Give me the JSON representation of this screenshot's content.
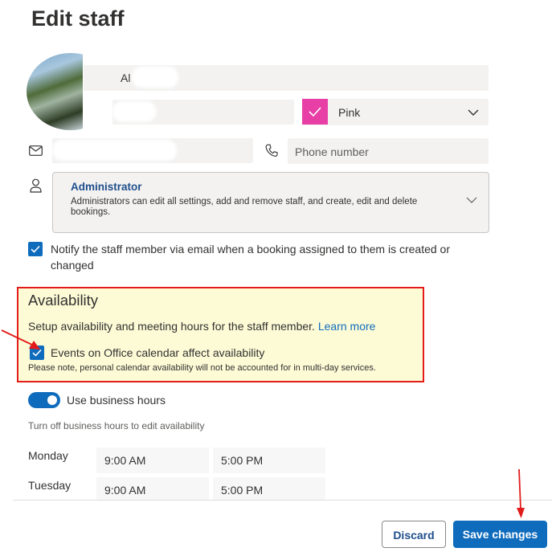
{
  "header": {
    "title": "Edit staff"
  },
  "profile": {
    "name_partial": "Al",
    "color_value": "Pink",
    "phone_placeholder": "Phone number"
  },
  "role": {
    "name": "Administrator",
    "description": "Administrators can edit all settings, add and remove staff, and create, edit and delete bookings."
  },
  "notify": {
    "checked": true,
    "label": "Notify the staff member via email when a booking assigned to them is created or changed"
  },
  "availability": {
    "heading": "Availability",
    "description": "Setup availability and meeting hours for the staff member.",
    "learn_more": "Learn more",
    "office_calendar_checked": true,
    "office_calendar_label": "Events on Office calendar affect availability",
    "note": "Please note, personal calendar availability will not be accounted for in multi-day services."
  },
  "business_hours": {
    "enabled": true,
    "label": "Use business hours",
    "hint": "Turn off business hours to edit availability",
    "days": [
      {
        "day": "Monday",
        "start": "9:00 AM",
        "end": "5:00 PM"
      },
      {
        "day": "Tuesday",
        "start": "9:00 AM",
        "end": "5:00 PM"
      }
    ]
  },
  "footer": {
    "discard_label": "Discard",
    "save_label": "Save changes"
  },
  "colors": {
    "accent": "#0f6cbd",
    "highlight_border": "#e21b1b",
    "highlight_bg": "#fdfbd6",
    "staff_color": "#e83fa6"
  }
}
